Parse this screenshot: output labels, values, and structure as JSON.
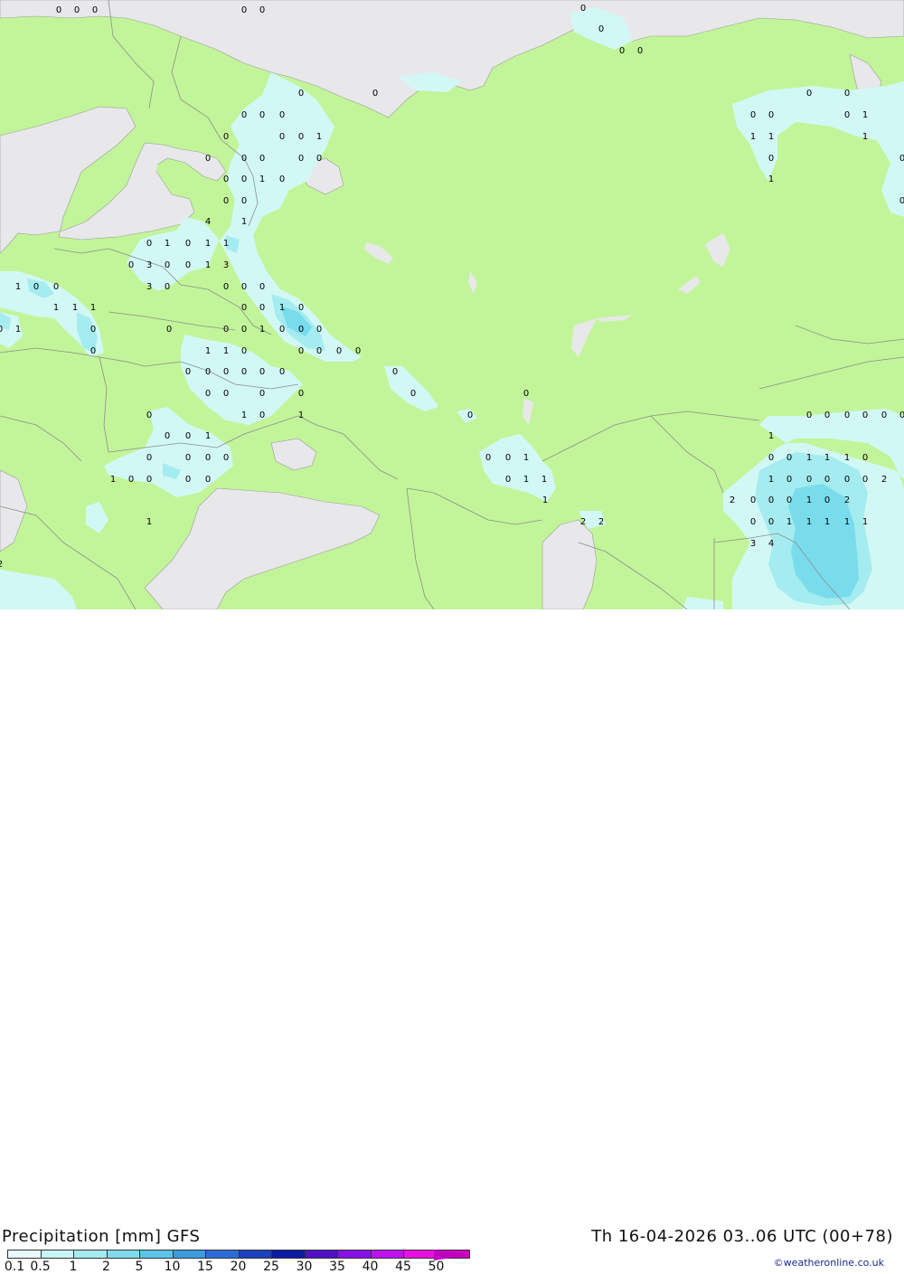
{
  "map": {
    "colors": {
      "land": "#c2f59a",
      "sea": "#e8e8ea",
      "precip_light": "#d2f8f6",
      "precip_mid": "#a4ecef",
      "precip_high": "#78dced",
      "border": "#8c8c8c"
    },
    "labels": [
      {
        "v": "0"
      },
      {
        "v": "0"
      },
      {
        "v": "0"
      },
      {
        "v": "0"
      },
      {
        "v": "0"
      },
      {
        "v": "0"
      },
      {
        "v": "0"
      },
      {
        "v": "0"
      },
      {
        "v": "0"
      },
      {
        "v": "0"
      },
      {
        "v": "0"
      },
      {
        "v": "0"
      },
      {
        "v": "0"
      },
      {
        "v": "0"
      },
      {
        "v": "0"
      },
      {
        "v": "0"
      },
      {
        "v": "0"
      },
      {
        "v": "0"
      },
      {
        "v": "0"
      },
      {
        "v": "1"
      },
      {
        "v": "0"
      },
      {
        "v": "0"
      },
      {
        "v": "0"
      },
      {
        "v": "1"
      },
      {
        "v": "1"
      },
      {
        "v": "1"
      },
      {
        "v": "1"
      },
      {
        "v": "0"
      },
      {
        "v": "0"
      },
      {
        "v": "0"
      },
      {
        "v": "0"
      },
      {
        "v": "0"
      },
      {
        "v": "0"
      },
      {
        "v": "0"
      },
      {
        "v": "0"
      },
      {
        "v": "0"
      },
      {
        "v": "1"
      },
      {
        "v": "0"
      },
      {
        "v": "1"
      },
      {
        "v": "0"
      },
      {
        "v": "0"
      },
      {
        "v": "0"
      },
      {
        "v": "4"
      },
      {
        "v": "1"
      },
      {
        "v": "0"
      },
      {
        "v": "1"
      },
      {
        "v": "0"
      },
      {
        "v": "1"
      },
      {
        "v": "1"
      },
      {
        "v": "0"
      },
      {
        "v": "3"
      },
      {
        "v": "0"
      },
      {
        "v": "0"
      },
      {
        "v": "1"
      },
      {
        "v": "3"
      },
      {
        "v": "1"
      },
      {
        "v": "0"
      },
      {
        "v": "0"
      },
      {
        "v": "3"
      },
      {
        "v": "0"
      },
      {
        "v": "0"
      },
      {
        "v": "0"
      },
      {
        "v": "0"
      },
      {
        "v": "1"
      },
      {
        "v": "1"
      },
      {
        "v": "1"
      },
      {
        "v": "0"
      },
      {
        "v": "0"
      },
      {
        "v": "1"
      },
      {
        "v": "0"
      },
      {
        "v": "0"
      },
      {
        "v": "1"
      },
      {
        "v": "0"
      },
      {
        "v": "0"
      },
      {
        "v": "0"
      },
      {
        "v": "0"
      },
      {
        "v": "1"
      },
      {
        "v": "0"
      },
      {
        "v": "0"
      },
      {
        "v": "0"
      },
      {
        "v": "0"
      },
      {
        "v": "1"
      },
      {
        "v": "1"
      },
      {
        "v": "0"
      },
      {
        "v": "0"
      },
      {
        "v": "0"
      },
      {
        "v": "0"
      },
      {
        "v": "0"
      },
      {
        "v": "0"
      },
      {
        "v": "0"
      },
      {
        "v": "0"
      },
      {
        "v": "0"
      },
      {
        "v": "0"
      },
      {
        "v": "0"
      },
      {
        "v": "0"
      },
      {
        "v": "0"
      },
      {
        "v": "0"
      },
      {
        "v": "0"
      },
      {
        "v": "0"
      },
      {
        "v": "0"
      },
      {
        "v": "0"
      },
      {
        "v": "0"
      },
      {
        "v": "1"
      },
      {
        "v": "0"
      },
      {
        "v": "1"
      },
      {
        "v": "0"
      },
      {
        "v": "0"
      },
      {
        "v": "0"
      },
      {
        "v": "0"
      },
      {
        "v": "0"
      },
      {
        "v": "0"
      },
      {
        "v": "0"
      },
      {
        "v": "0"
      },
      {
        "v": "0"
      },
      {
        "v": "1"
      },
      {
        "v": "1"
      },
      {
        "v": "0"
      },
      {
        "v": "0"
      },
      {
        "v": "0"
      },
      {
        "v": "0"
      },
      {
        "v": "0"
      },
      {
        "v": "0"
      },
      {
        "v": "1"
      },
      {
        "v": "0"
      },
      {
        "v": "0"
      },
      {
        "v": "1"
      },
      {
        "v": "1"
      },
      {
        "v": "1"
      },
      {
        "v": "0"
      },
      {
        "v": "1"
      },
      {
        "v": "0"
      },
      {
        "v": "0"
      },
      {
        "v": "0"
      },
      {
        "v": "0"
      },
      {
        "v": "0"
      },
      {
        "v": "1"
      },
      {
        "v": "1"
      },
      {
        "v": "1"
      },
      {
        "v": "0"
      },
      {
        "v": "0"
      },
      {
        "v": "0"
      },
      {
        "v": "0"
      },
      {
        "v": "0"
      },
      {
        "v": "2"
      },
      {
        "v": "1"
      },
      {
        "v": "2"
      },
      {
        "v": "0"
      },
      {
        "v": "0"
      },
      {
        "v": "0"
      },
      {
        "v": "1"
      },
      {
        "v": "0"
      },
      {
        "v": "2"
      },
      {
        "v": "1"
      },
      {
        "v": "2"
      },
      {
        "v": "2"
      },
      {
        "v": "0"
      },
      {
        "v": "0"
      },
      {
        "v": "1"
      },
      {
        "v": "1"
      },
      {
        "v": "1"
      },
      {
        "v": "1"
      },
      {
        "v": "1"
      },
      {
        "v": "2"
      },
      {
        "v": "3"
      },
      {
        "v": "4"
      }
    ]
  },
  "footer": {
    "title": "Precipitation [mm] GFS",
    "run": "Th 16-04-2026 03..06 UTC (00+78)",
    "credit": "©weatheronline.co.uk",
    "scale": [
      {
        "label": "0.1",
        "color": "#e6fcfc"
      },
      {
        "label": "0.5",
        "color": "#c8f6f8"
      },
      {
        "label": "1",
        "color": "#a4ecf0"
      },
      {
        "label": "2",
        "color": "#80dcec"
      },
      {
        "label": "5",
        "color": "#5cc4e8"
      },
      {
        "label": "10",
        "color": "#3c9ce0"
      },
      {
        "label": "15",
        "color": "#2c6cd8"
      },
      {
        "label": "20",
        "color": "#1c40c0"
      },
      {
        "label": "25",
        "color": "#0c1ca4"
      },
      {
        "label": "30",
        "color": "#5010c8"
      },
      {
        "label": "35",
        "color": "#8810e8"
      },
      {
        "label": "40",
        "color": "#c010f0"
      },
      {
        "label": "45",
        "color": "#e810e0"
      },
      {
        "label": "50",
        "color": "#d000c0"
      }
    ]
  }
}
